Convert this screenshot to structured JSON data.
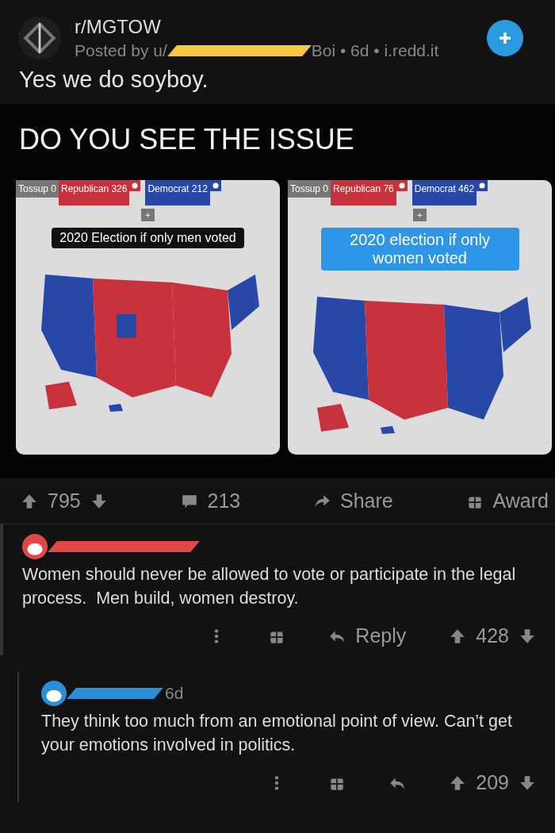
{
  "post": {
    "subreddit": "r/MGTOW",
    "posted_by": "Posted by u/",
    "posted_by_tail": "Boi • 6d • i.redd.it",
    "title": "Yes we do soyboy.",
    "image": {
      "headline": "DO YOU SEE THE ISSUE",
      "panels": [
        {
          "tossup": "Tossup 0",
          "republican": "Republican 326",
          "democrat": "Democrat 212",
          "plus": "+",
          "caption": "2020 Election if only men voted",
          "kind": "red-majority"
        },
        {
          "tossup": "Tossup 0",
          "republican": "Republican 76",
          "democrat": "Democrat 462",
          "plus": "+",
          "caption": "2020 election if only women voted",
          "kind": "blue-majority"
        }
      ]
    },
    "actions": {
      "votes": "795",
      "comments": "213",
      "share": "Share",
      "award": "Award"
    }
  },
  "comments": [
    {
      "color": "#e04848",
      "text": "Women should never be allowed to vote or participate in the legal process.  Men build, women destroy.",
      "reply": "Reply",
      "votes": "428",
      "nested": false
    },
    {
      "color": "#2a8fd8",
      "time": "6d",
      "text": "They think too much from an emotional point of view. Can’t get your emotions involved in politics.",
      "votes": "209",
      "nested": true
    }
  ]
}
